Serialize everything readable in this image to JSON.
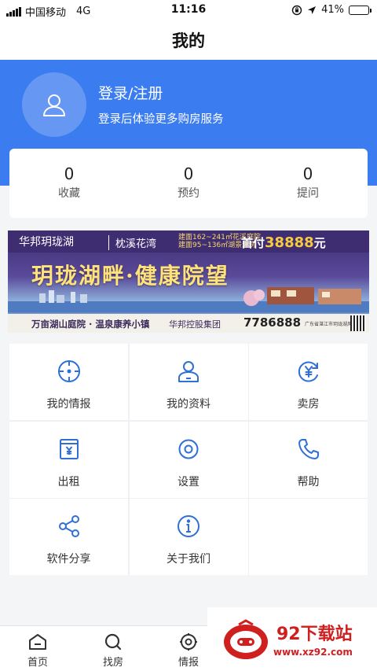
{
  "status_bar": {
    "carrier": "中国移动",
    "network": "4G",
    "time": "11:16",
    "battery": "41%",
    "battery_level": 0.41
  },
  "nav": {
    "title": "我的"
  },
  "profile": {
    "login_label": "登录/注册",
    "login_hint": "登录后体验更多购房服务",
    "avatar_icon": "user-icon"
  },
  "stats": [
    {
      "count": "0",
      "label": "收藏"
    },
    {
      "count": "0",
      "label": "预约"
    },
    {
      "count": "0",
      "label": "提问"
    }
  ],
  "banner": {
    "brand": "华邦玥珑湖",
    "brand2": "枕溪花湾",
    "area_1": "建面162~241㎡花溪庭院",
    "area_2": "建面95~136㎡湖景洋房",
    "price_prefix": "首付",
    "price_value": "38888",
    "price_unit": "元",
    "slogan": "玥珑湖畔·健康院望",
    "tagline": "万亩湖山庭院 · 温泉康养小镇",
    "group": "华邦控股集团",
    "phone": "7786888",
    "address": "广东省湛江市玥珑湖风景区"
  },
  "menu": [
    {
      "label": "我的情报",
      "icon": "crosshair-icon"
    },
    {
      "label": "我的资料",
      "icon": "profile-icon"
    },
    {
      "label": "卖房",
      "icon": "yen-cycle-icon"
    },
    {
      "label": "出租",
      "icon": "rent-box-icon"
    },
    {
      "label": "设置",
      "icon": "gear-icon"
    },
    {
      "label": "帮助",
      "icon": "phone-icon"
    },
    {
      "label": "软件分享",
      "icon": "share-icon"
    },
    {
      "label": "关于我们",
      "icon": "info-icon"
    }
  ],
  "tabs": [
    {
      "label": "首页",
      "icon": "home-icon"
    },
    {
      "label": "找房",
      "icon": "search-icon"
    },
    {
      "label": "情报",
      "icon": "target-icon"
    }
  ],
  "watermark": {
    "title": "92下载站",
    "url": "www.xz92.com"
  },
  "colors": {
    "primary": "#3b7cf0",
    "icon_blue": "#2f6fd6",
    "watermark_red": "#d01f1f"
  }
}
